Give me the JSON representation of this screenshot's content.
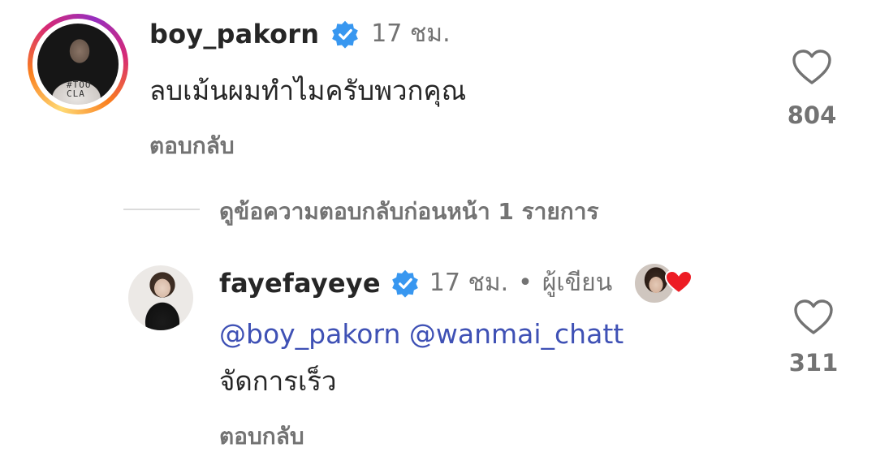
{
  "comments": [
    {
      "username": "boy_pakorn",
      "time": "17 ชม.",
      "text": "ลบเม้นผมทำไมครับพวกคุณ",
      "reply_label": "ตอบกลับ",
      "likes": "804"
    },
    {
      "username": "fayefayeye",
      "time": "17 ชม.",
      "separator": "•",
      "author_label": "ผู้เขียน",
      "mentions": [
        "@boy_pakorn",
        "@wanmai_chatt"
      ],
      "text": "จัดการเร็ว",
      "reply_label": "ตอบกลับ",
      "likes": "311"
    }
  ],
  "view_previous_replies": "ดูข้อความตอบกลับก่อนหน้า 1 รายการ",
  "avatar1_shirt_text": "#TOO\nCLA",
  "colors": {
    "verified": "#3897f0",
    "heart_badge": "#ed1c24",
    "mention": "#3f51b5",
    "secondary_text": "#737373"
  },
  "icons": {
    "verified": "verified-badge-icon",
    "like": "heart-outline-icon",
    "author_heart": "heart-filled-icon"
  }
}
